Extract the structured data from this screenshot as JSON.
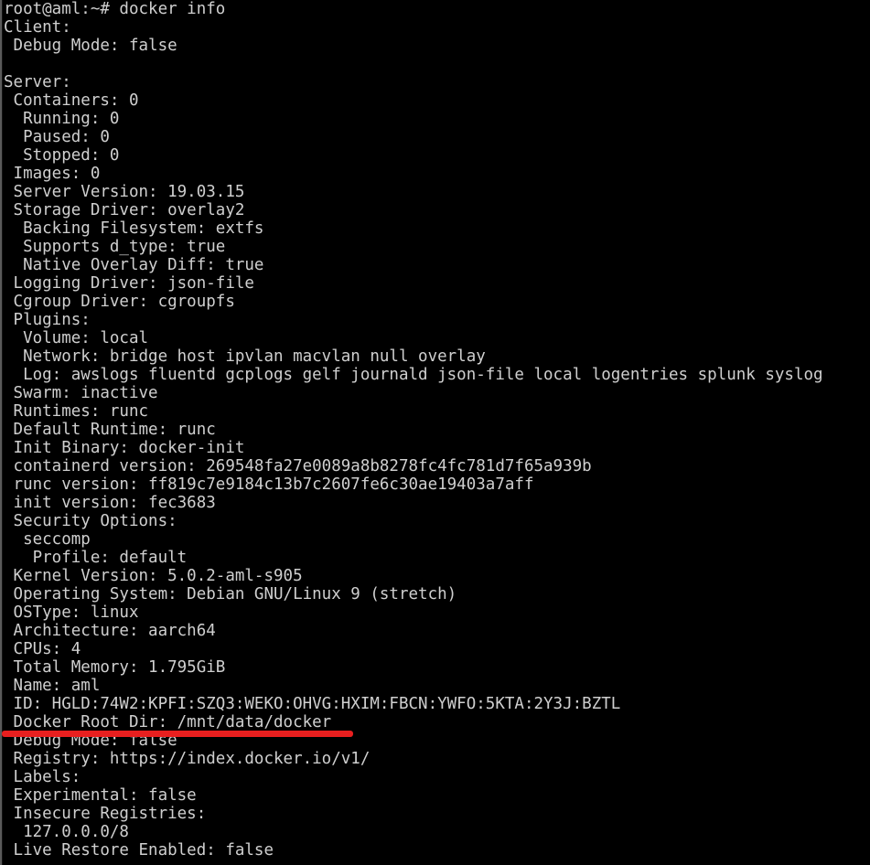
{
  "terminal": {
    "window_title": "docker info",
    "prompt": "root@aml:~#",
    "command": "docker info",
    "text_color": "#cfcfcf",
    "background_color": "#000000",
    "annotation_color": "#e81f1f",
    "annotation_target": "Docker Root Dir: /mnt/data/docker",
    "lines": [
      "root@aml:~# docker info",
      "Client:",
      " Debug Mode: false",
      "",
      "Server:",
      " Containers: 0",
      "  Running: 0",
      "  Paused: 0",
      "  Stopped: 0",
      " Images: 0",
      " Server Version: 19.03.15",
      " Storage Driver: overlay2",
      "  Backing Filesystem: extfs",
      "  Supports d_type: true",
      "  Native Overlay Diff: true",
      " Logging Driver: json-file",
      " Cgroup Driver: cgroupfs",
      " Plugins:",
      "  Volume: local",
      "  Network: bridge host ipvlan macvlan null overlay",
      "  Log: awslogs fluentd gcplogs gelf journald json-file local logentries splunk syslog",
      " Swarm: inactive",
      " Runtimes: runc",
      " Default Runtime: runc",
      " Init Binary: docker-init",
      " containerd version: 269548fa27e0089a8b8278fc4fc781d7f65a939b",
      " runc version: ff819c7e9184c13b7c2607fe6c30ae19403a7aff",
      " init version: fec3683",
      " Security Options:",
      "  seccomp",
      "   Profile: default",
      " Kernel Version: 5.0.2-aml-s905",
      " Operating System: Debian GNU/Linux 9 (stretch)",
      " OSType: linux",
      " Architecture: aarch64",
      " CPUs: 4",
      " Total Memory: 1.795GiB",
      " Name: aml",
      " ID: HGLD:74W2:KPFI:SZQ3:WEKO:OHVG:HXIM:FBCN:YWFO:5KTA:2Y3J:BZTL",
      " Docker Root Dir: /mnt/data/docker",
      " Debug Mode: false",
      " Registry: https://index.docker.io/v1/",
      " Labels:",
      " Experimental: false",
      " Insecure Registries:",
      "  127.0.0.0/8",
      " Live Restore Enabled: false"
    ]
  }
}
